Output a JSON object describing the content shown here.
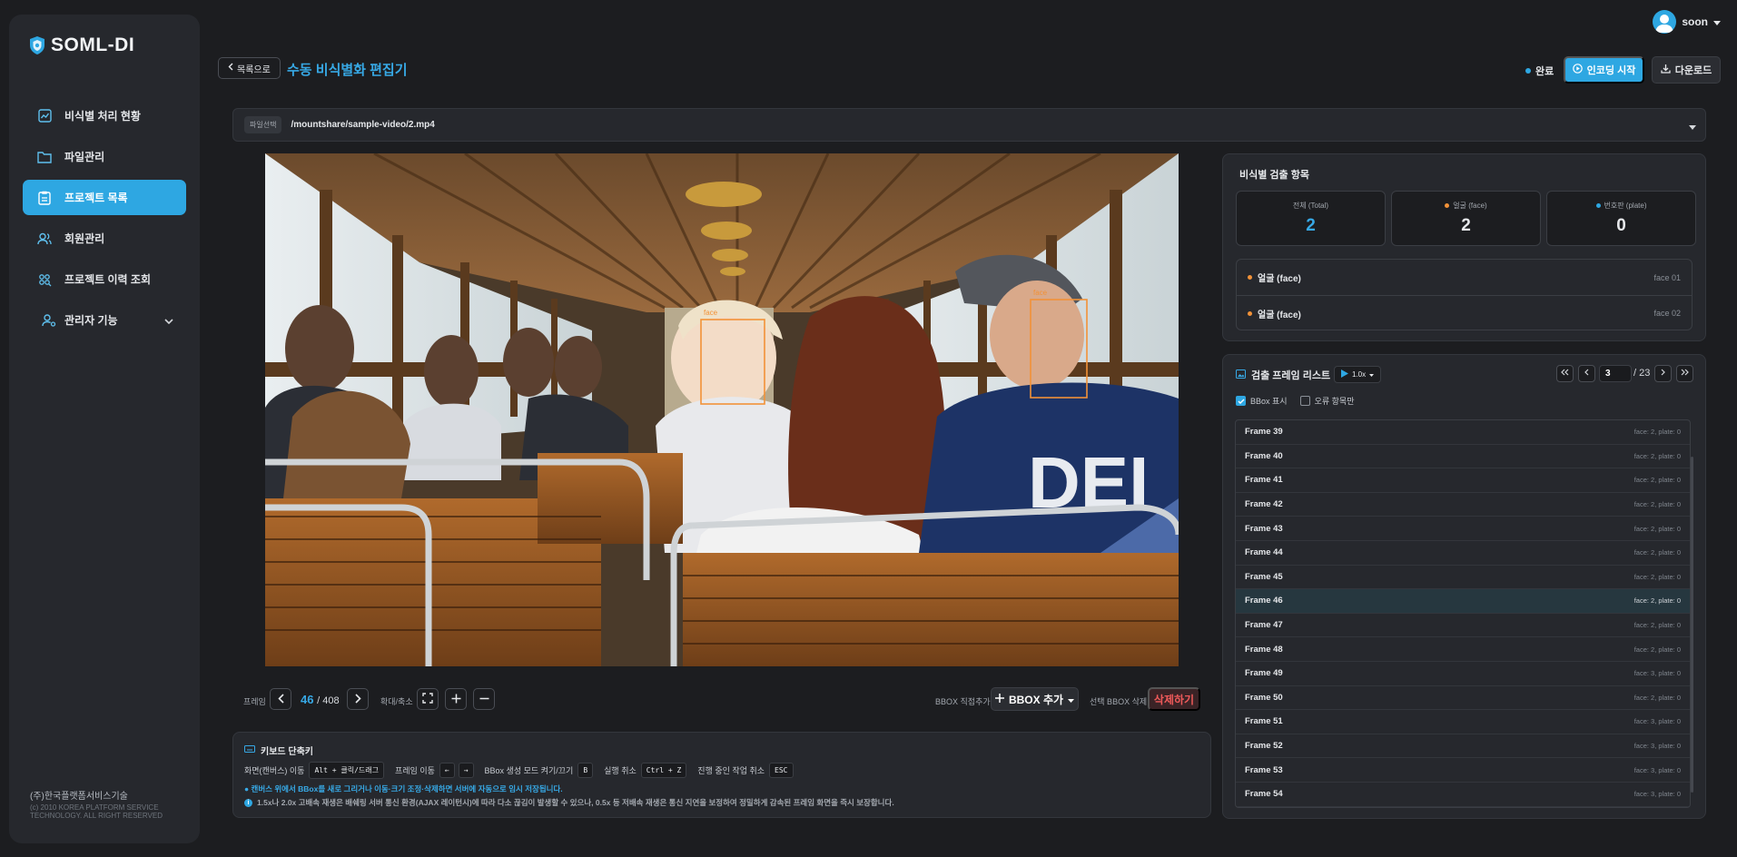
{
  "app": {
    "logo_text": "SOML-DI"
  },
  "sidebar": {
    "items": [
      {
        "label": "비식별 처리 현황",
        "icon": "chart-icon",
        "active": false
      },
      {
        "label": "파일관리",
        "icon": "folder-icon",
        "active": false
      },
      {
        "label": "프로젝트 목록",
        "icon": "clipboard-icon",
        "active": true
      },
      {
        "label": "회원관리",
        "icon": "users-icon",
        "active": false
      },
      {
        "label": "프로젝트 이력 조회",
        "icon": "history-icon",
        "active": false
      },
      {
        "label": "관리자 기능",
        "icon": "admin-icon",
        "active": false
      }
    ],
    "company_name": "(주)한국플랫폼서비스기술",
    "copyright": "(c) 2010 KOREA PLATFORM SERVICE TECHNOLOGY. ALL RIGHT RESERVED"
  },
  "header": {
    "user_name": "soon",
    "back_label": "목록으로",
    "title": "수동 비식별화 편집기",
    "status": "완료",
    "encode_label": "인코딩 시작",
    "download_label": "다운로드"
  },
  "file": {
    "label": "파일선택",
    "path": "/mountshare/sample-video/2.mp4"
  },
  "video": {
    "bbox_label": "face"
  },
  "controls": {
    "frame_label": "프레임",
    "current_frame": "46",
    "total_frames": "/ 408",
    "zoom_label": "확대/축소",
    "bbox_direct_label": "BBOX 직접추가",
    "bbox_add_label": "BBOX 추가",
    "selected_delete_label": "선택 BBOX 삭제",
    "delete_label": "삭제하기"
  },
  "keyboard": {
    "title": "키보드 단축키",
    "shortcuts": [
      {
        "label": "화면(캔버스) 이동",
        "keys": "Alt + 클릭/드래그"
      },
      {
        "label": "프레임 이동",
        "keys": [
          "←",
          "→"
        ]
      },
      {
        "label": "BBox 생성 모드 켜기/끄기",
        "keys": "B"
      },
      {
        "label": "실행 취소",
        "keys": "Ctrl + Z"
      },
      {
        "label": "진행 중인 작업 취소",
        "keys": "ESC"
      }
    ],
    "note1": "● 캔버스 위에서 BBox를 새로 그리거나 이동·크기 조정·삭제하면 서버에 자동으로 임시 저장됩니다.",
    "note2": "1.5x나 2.0x 고배속 재생은 배쉐링 서버 통신 환경(AJAX 레이턴시)에 따라 다소 끊김이 발생할 수 있으나, 0.5x 등 저배속 재생은 통신 지연을 보정하여 정밀하게 감속된 프레임 화면을 즉시 보장합니다."
  },
  "stats": {
    "title": "비식별 검출 항목",
    "cards": [
      {
        "label": "전체 (Total)",
        "value": "2",
        "accent": "#37a9e6"
      },
      {
        "label": "얼굴 (face)",
        "value": "2",
        "accent": "#ffffff"
      },
      {
        "label": "번호판 (plate)",
        "value": "0",
        "accent": "#ffffff"
      }
    ],
    "detections": [
      {
        "label": "얼굴 (face)",
        "id": "face 01"
      },
      {
        "label": "얼굴 (face)",
        "id": "face 02"
      }
    ]
  },
  "frames": {
    "title": "검출 프레임 리스트",
    "speed": "1.0x",
    "page": "3",
    "pages": "/ 23",
    "show_bbox_label": "BBox 표시",
    "errors_only_label": "오류 항목만",
    "show_bbox_checked": true,
    "errors_only_checked": false,
    "list": [
      {
        "name": "Frame 39",
        "meta": "face: 2, plate: 0"
      },
      {
        "name": "Frame 40",
        "meta": "face: 2, plate: 0"
      },
      {
        "name": "Frame 41",
        "meta": "face: 2, plate: 0"
      },
      {
        "name": "Frame 42",
        "meta": "face: 2, plate: 0"
      },
      {
        "name": "Frame 43",
        "meta": "face: 2, plate: 0"
      },
      {
        "name": "Frame 44",
        "meta": "face: 2, plate: 0"
      },
      {
        "name": "Frame 45",
        "meta": "face: 2, plate: 0"
      },
      {
        "name": "Frame 46",
        "meta": "face: 2, plate: 0",
        "selected": true
      },
      {
        "name": "Frame 47",
        "meta": "face: 2, plate: 0"
      },
      {
        "name": "Frame 48",
        "meta": "face: 2, plate: 0"
      },
      {
        "name": "Frame 49",
        "meta": "face: 3, plate: 0"
      },
      {
        "name": "Frame 50",
        "meta": "face: 2, plate: 0"
      },
      {
        "name": "Frame 51",
        "meta": "face: 3, plate: 0"
      },
      {
        "name": "Frame 52",
        "meta": "face: 3, plate: 0"
      },
      {
        "name": "Frame 53",
        "meta": "face: 3, plate: 0"
      },
      {
        "name": "Frame 54",
        "meta": "face: 3, plate: 0"
      }
    ]
  },
  "colors": {
    "accent": "#2ea7e2",
    "face": "#f29238",
    "danger": "#f05a5a"
  }
}
